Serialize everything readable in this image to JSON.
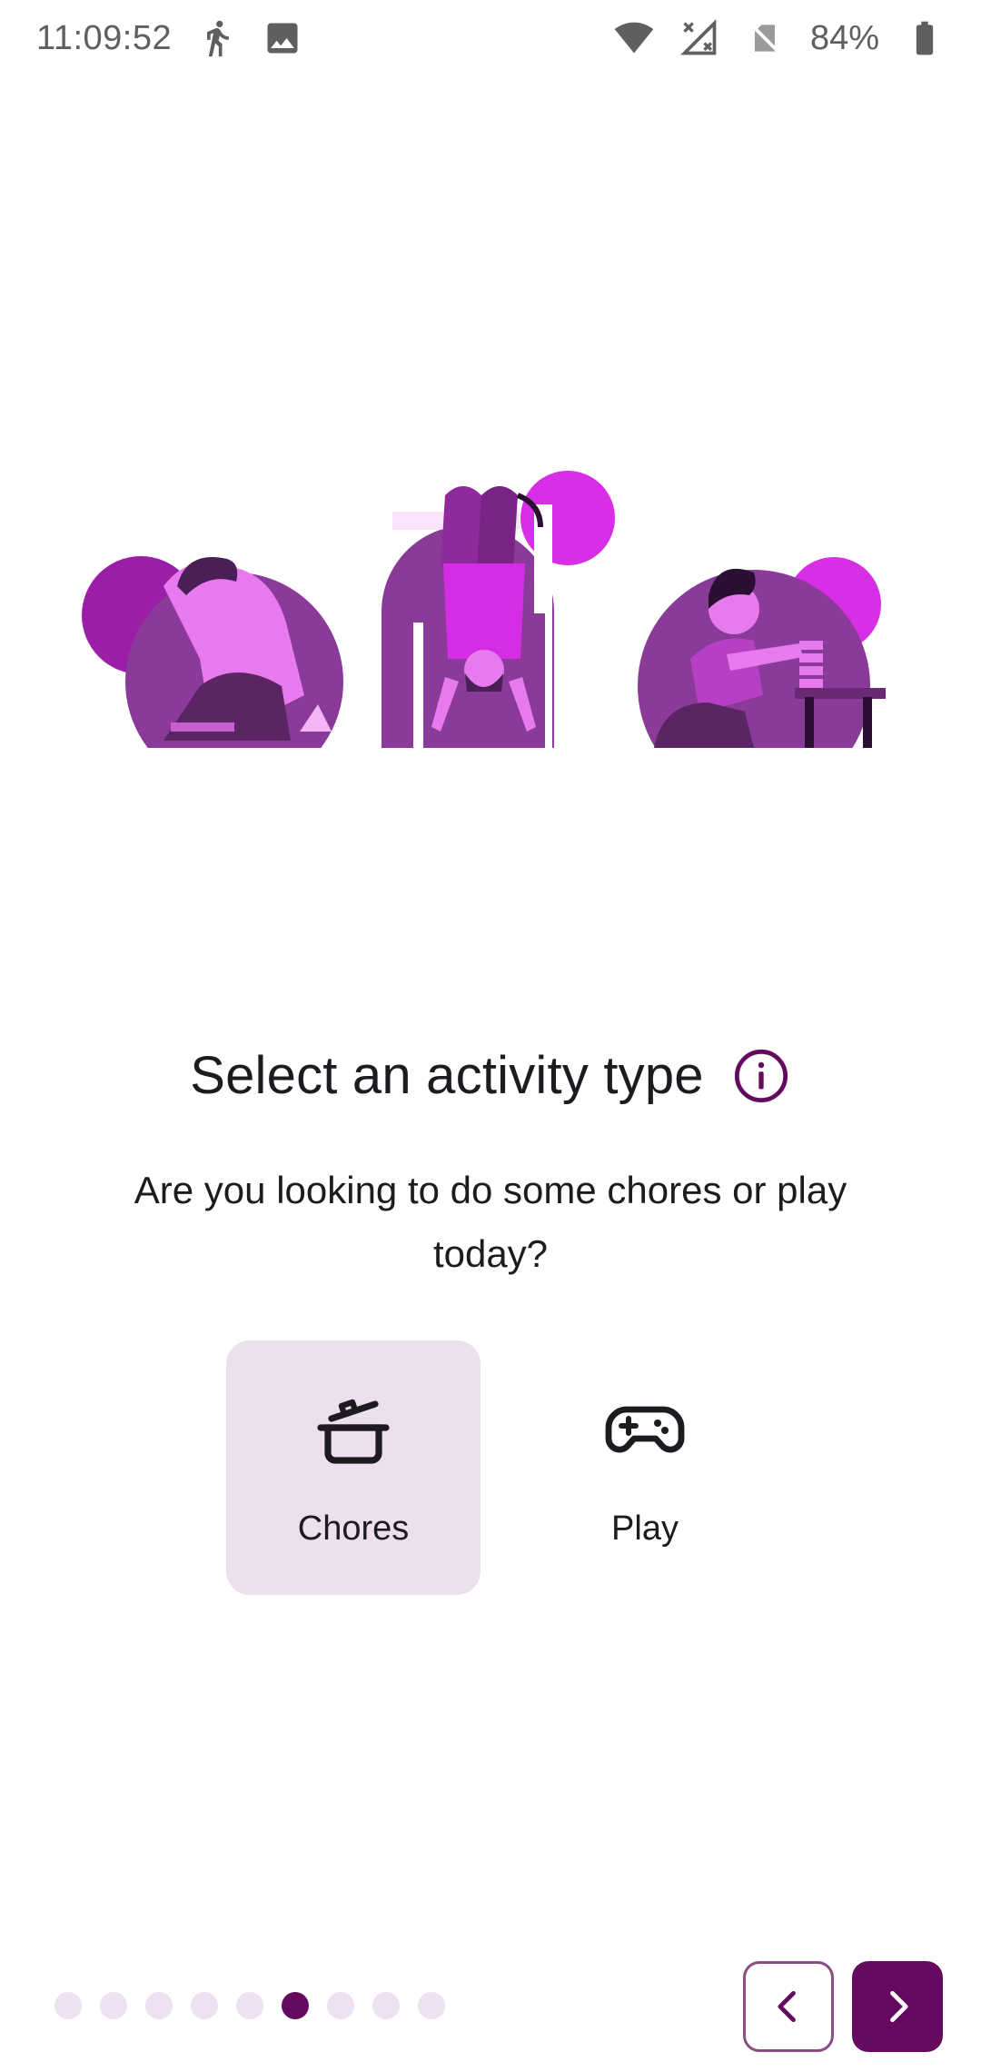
{
  "status_bar": {
    "time": "11:09:52",
    "battery": "84%",
    "icons": [
      "walking-icon",
      "image-icon",
      "wifi-icon",
      "no-signal-icon",
      "no-sim-icon",
      "battery-icon"
    ]
  },
  "illustration": {
    "description_icons": [
      "kneeling-person",
      "hanging-person",
      "stacking-person"
    ],
    "colors": {
      "dark": "#8a3a98",
      "bright": "#c21fcf",
      "light": "#e87aef",
      "shadow": "#5a2563"
    }
  },
  "header": {
    "title": "Select an activity type",
    "info_icon": "info-icon"
  },
  "subtitle": "Are you looking to do some chores or play today?",
  "options": [
    {
      "label": "Chores",
      "icon": "pot-icon",
      "selected": true
    },
    {
      "label": "Play",
      "icon": "gamepad-icon",
      "selected": false
    }
  ],
  "pagination": {
    "total": 9,
    "active_index": 5
  },
  "nav": {
    "back_icon": "chevron-left-icon",
    "next_icon": "chevron-right-icon"
  },
  "colors": {
    "accent": "#65095f",
    "selected_bg": "#ecdfee",
    "dot_inactive": "#eee1f1",
    "text": "#1d1b20"
  }
}
